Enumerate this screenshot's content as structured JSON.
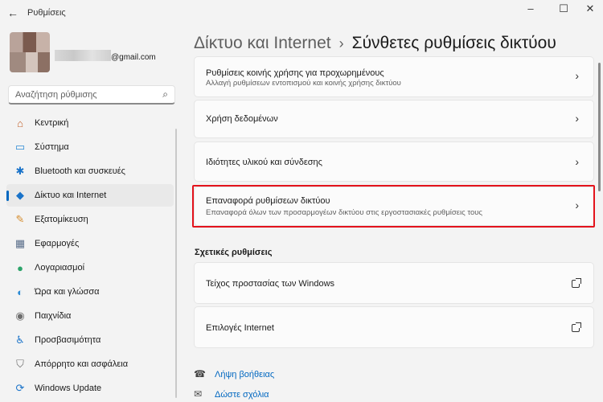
{
  "window": {
    "back_icon": "←",
    "title": "Ρυθμίσεις",
    "minimize": "–",
    "maximize": "☐",
    "close": "✕"
  },
  "profile": {
    "email": "@gmail.com"
  },
  "search": {
    "placeholder": "Αναζήτηση ρύθμισης",
    "icon": "⌕"
  },
  "sidebar": {
    "items": [
      {
        "label": "Κεντρική",
        "icon": "home-icon",
        "glyph": "⌂",
        "color": "#c3612b"
      },
      {
        "label": "Σύστημα",
        "icon": "system-icon",
        "glyph": "▭",
        "color": "#2a8ad4"
      },
      {
        "label": "Bluetooth και συσκευές",
        "icon": "bluetooth-icon",
        "glyph": "✱",
        "color": "#1a73c9"
      },
      {
        "label": "Δίκτυο και Internet",
        "icon": "wifi-icon",
        "glyph": "◆",
        "color": "#1a73c9"
      },
      {
        "label": "Εξατομίκευση",
        "icon": "brush-icon",
        "glyph": "✎",
        "color": "#d58a2a"
      },
      {
        "label": "Εφαρμογές",
        "icon": "apps-icon",
        "glyph": "▦",
        "color": "#5a6e8a"
      },
      {
        "label": "Λογαριασμοί",
        "icon": "account-icon",
        "glyph": "●",
        "color": "#2ca46a"
      },
      {
        "label": "Ώρα και γλώσσα",
        "icon": "globe-icon",
        "glyph": "◐",
        "color": "#2a8ad4"
      },
      {
        "label": "Παιχνίδια",
        "icon": "gamepad-icon",
        "glyph": "◉",
        "color": "#6e6e6e"
      },
      {
        "label": "Προσβασιμότητα",
        "icon": "accessibility-icon",
        "glyph": "♿",
        "color": "#1a73c9"
      },
      {
        "label": "Απόρρητο και ασφάλεια",
        "icon": "shield-icon",
        "glyph": "⛉",
        "color": "#6e6e6e"
      },
      {
        "label": "Windows Update",
        "icon": "update-icon",
        "glyph": "⟳",
        "color": "#1a73c9"
      }
    ],
    "active_index": 3
  },
  "header": {
    "parent": "Δίκτυο και Internet",
    "separator": "›",
    "current": "Σύνθετες ρυθμίσεις δικτύου"
  },
  "cards": [
    {
      "title": "Ρυθμίσεις κοινής χρήσης για προχωρημένους",
      "subtitle": "Αλλαγή ρυθμίσεων εντοπισμού και κοινής χρήσης δικτύου",
      "action": "›"
    },
    {
      "title": "Χρήση δεδομένων",
      "subtitle": "",
      "action": "›"
    },
    {
      "title": "Ιδιότητες υλικού και σύνδεσης",
      "subtitle": "",
      "action": "›"
    },
    {
      "title": "Επαναφορά ρυθμίσεων δικτύου",
      "subtitle": "Επαναφορά όλων των προσαρμογέων δικτύου στις εργοστασιακές ρυθμίσεις τους",
      "action": "›"
    }
  ],
  "related": {
    "title": "Σχετικές ρυθμίσεις",
    "items": [
      {
        "title": "Τείχος προστασίας των Windows"
      },
      {
        "title": "Επιλογές Internet"
      }
    ]
  },
  "help": {
    "get_help": "Λήψη βοήθειας",
    "feedback": "Δώστε σχόλια"
  },
  "colors": {
    "accent": "#0067c0",
    "highlight": "#e3131c"
  }
}
